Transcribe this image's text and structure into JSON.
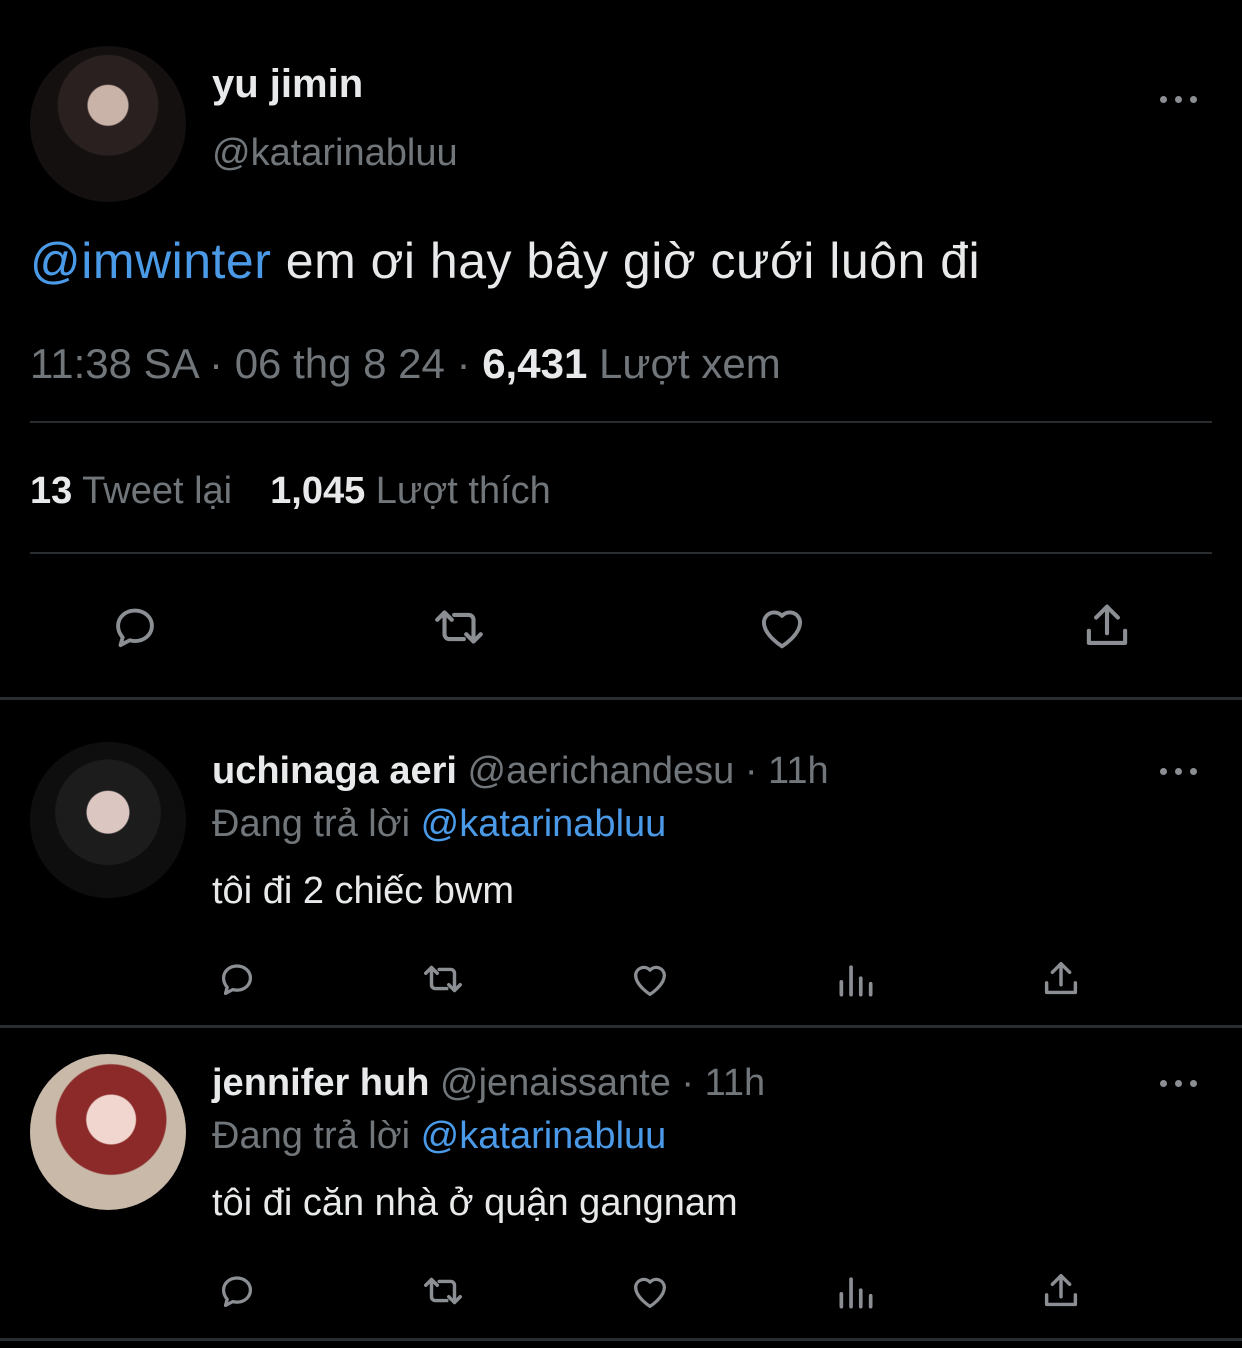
{
  "tweet": {
    "author_name": "yu jimin",
    "author_handle": "@katarinabluu",
    "mention": "@imwinter",
    "text": " em ơi hay bây giờ cưới luôn đi",
    "time": "11:38 SA · 06 thg 8 24 · ",
    "views_count": "6,431",
    "views_label": " Lượt xem",
    "retweets_count": "13",
    "retweets_label": " Tweet lại",
    "likes_count": "1,045",
    "likes_label": " Lượt thích"
  },
  "replies": [
    {
      "name": "uchinaga aeri",
      "handle_time": " @aerichandesu · 11h",
      "replying_label": "Đang trả lời ",
      "replying_to": "@katarinabluu",
      "text": "tôi đi 2 chiếc bwm"
    },
    {
      "name": "jennifer huh",
      "handle_time": " @jenaissante · 11h",
      "replying_label": "Đang trả lời ",
      "replying_to": "@katarinabluu",
      "text": "tôi đi căn nhà ở quận gangnam"
    }
  ],
  "colors": {
    "background": "#000000",
    "accent": "#4b9ae8",
    "secondary_text": "#71767b",
    "icon": "#8b8f94"
  }
}
